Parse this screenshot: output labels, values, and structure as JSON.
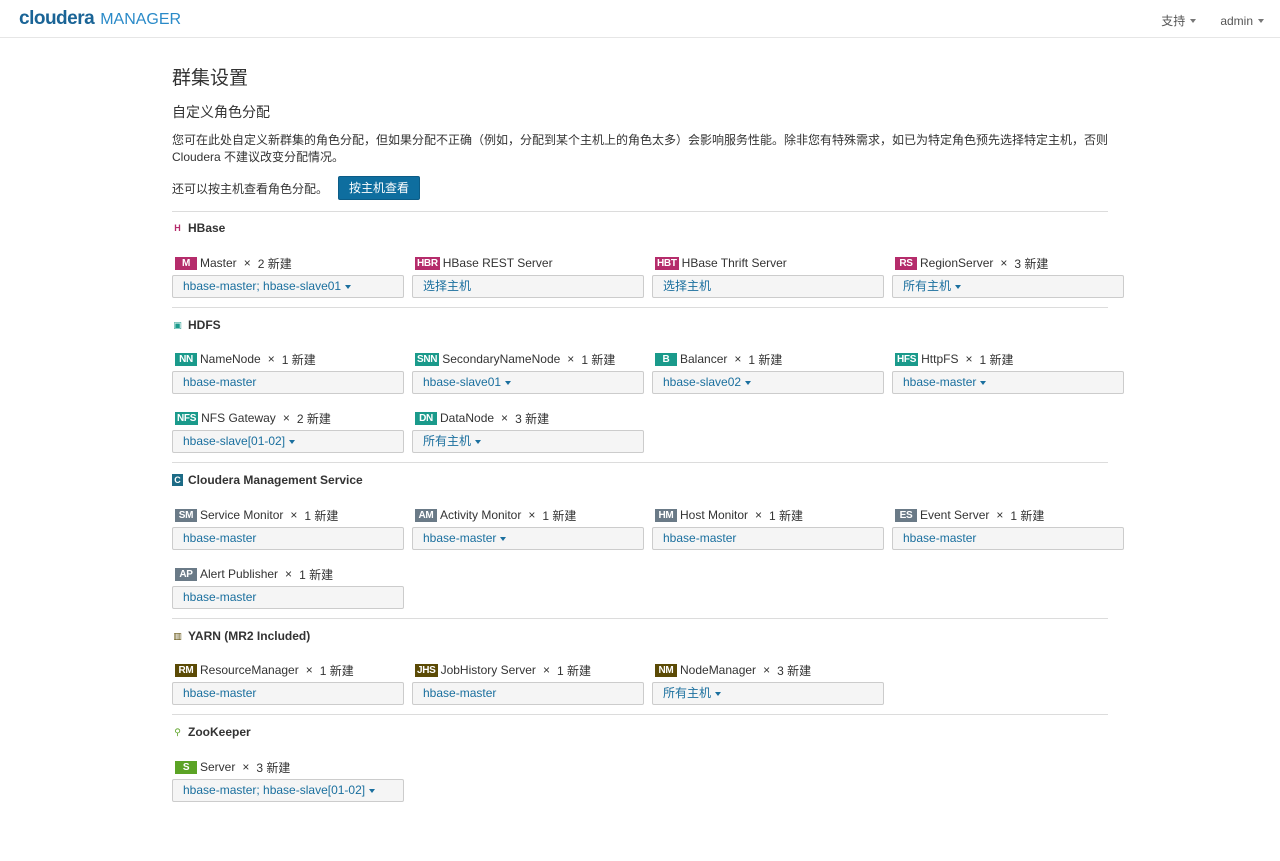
{
  "header": {
    "brand": "cloudera",
    "product": "MANAGER",
    "support": "支持",
    "user": "admin"
  },
  "page": {
    "title": "群集设置",
    "subtitle": "自定义角色分配",
    "description": "您可在此处自定义新群集的角色分配，但如果分配不正确（例如，分配到某个主机上的角色太多）会影响服务性能。除非您有特殊需求，如已为特定角色预先选择特定主机，否则 Cloudera 不建议改变分配情况。",
    "by_host_text": "还可以按主机查看角色分配。",
    "by_host_button": "按主机查看"
  },
  "colors": {
    "hbase": "#b52c6b",
    "hdfs": "#1a9a8b",
    "cms": "#6a7a87",
    "yarn": "#5b4a05",
    "zk": "#5ba325",
    "link": "#1a6f9e"
  },
  "services": [
    {
      "name": "HBase",
      "icon": "hbase-icon",
      "roles": [
        {
          "badge": "M",
          "name": "Master",
          "count": "2 新建",
          "hosts": "hbase-master; hbase-slave01",
          "dropdown": true
        },
        {
          "badge": "HBR",
          "name": "HBase REST Server",
          "count": "",
          "hosts": "选择主机",
          "dropdown": false
        },
        {
          "badge": "HBT",
          "name": "HBase Thrift Server",
          "count": "",
          "hosts": "选择主机",
          "dropdown": false
        },
        {
          "badge": "RS",
          "name": "RegionServer",
          "count": "3 新建",
          "hosts": "所有主机",
          "dropdown": true
        }
      ]
    },
    {
      "name": "HDFS",
      "icon": "hdfs-icon",
      "roles": [
        {
          "badge": "NN",
          "name": "NameNode",
          "count": "1 新建",
          "hosts": "hbase-master",
          "dropdown": false
        },
        {
          "badge": "SNN",
          "name": "SecondaryNameNode",
          "count": "1 新建",
          "hosts": "hbase-slave01",
          "dropdown": true
        },
        {
          "badge": "B",
          "name": "Balancer",
          "count": "1 新建",
          "hosts": "hbase-slave02",
          "dropdown": true
        },
        {
          "badge": "HFS",
          "name": "HttpFS",
          "count": "1 新建",
          "hosts": "hbase-master",
          "dropdown": true
        },
        {
          "badge": "NFS",
          "name": "NFS Gateway",
          "count": "2 新建",
          "hosts": "hbase-slave[01-02]",
          "dropdown": true
        },
        {
          "badge": "DN",
          "name": "DataNode",
          "count": "3 新建",
          "hosts": "所有主机",
          "dropdown": true
        }
      ]
    },
    {
      "name": "Cloudera Management Service",
      "icon": "cloudera-management-icon",
      "roles": [
        {
          "badge": "SM",
          "name": "Service Monitor",
          "count": "1 新建",
          "hosts": "hbase-master",
          "dropdown": false
        },
        {
          "badge": "AM",
          "name": "Activity Monitor",
          "count": "1 新建",
          "hosts": "hbase-master",
          "dropdown": true
        },
        {
          "badge": "HM",
          "name": "Host Monitor",
          "count": "1 新建",
          "hosts": "hbase-master",
          "dropdown": false
        },
        {
          "badge": "ES",
          "name": "Event Server",
          "count": "1 新建",
          "hosts": "hbase-master",
          "dropdown": false
        },
        {
          "badge": "AP",
          "name": "Alert Publisher",
          "count": "1 新建",
          "hosts": "hbase-master",
          "dropdown": false
        }
      ]
    },
    {
      "name": "YARN (MR2 Included)",
      "icon": "yarn-icon",
      "roles": [
        {
          "badge": "RM",
          "name": "ResourceManager",
          "count": "1 新建",
          "hosts": "hbase-master",
          "dropdown": false
        },
        {
          "badge": "JHS",
          "name": "JobHistory Server",
          "count": "1 新建",
          "hosts": "hbase-master",
          "dropdown": false
        },
        {
          "badge": "NM",
          "name": "NodeManager",
          "count": "3 新建",
          "hosts": "所有主机",
          "dropdown": true
        }
      ]
    },
    {
      "name": "ZooKeeper",
      "icon": "zookeeper-icon",
      "roles": [
        {
          "badge": "S",
          "name": "Server",
          "count": "3 新建",
          "hosts": "hbase-master; hbase-slave[01-02]",
          "dropdown": true
        }
      ]
    }
  ]
}
